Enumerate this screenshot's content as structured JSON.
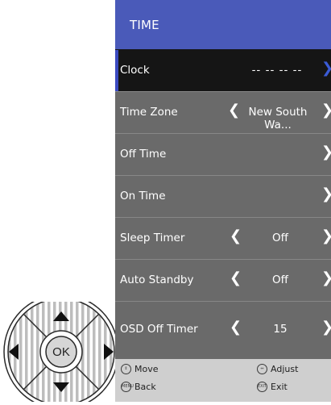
{
  "menu": {
    "title": "TIME",
    "rows": [
      {
        "label": "Clock",
        "value": "-- --   -- --"
      },
      {
        "label": "Time Zone",
        "value": "New South Wa..."
      },
      {
        "label": "Off Time",
        "value": ""
      },
      {
        "label": "On Time",
        "value": ""
      },
      {
        "label": "Sleep Timer",
        "value": "Off"
      },
      {
        "label": "Auto Standby",
        "value": "Off"
      },
      {
        "label": "OSD Off Timer",
        "value": "15"
      }
    ]
  },
  "footer": {
    "move": "Move",
    "adjust": "Adjust",
    "back": "Back",
    "exit": "Exit",
    "menu_key": "MENU",
    "exit_key": "EXIT"
  },
  "remote": {
    "ok_label": "OK"
  },
  "colors": {
    "header": "#4a5ab9",
    "menu_bg": "#6a6a6a",
    "selected_row": "#151515",
    "accent_arrow": "#3b5bd6",
    "footer_bg": "#cfcfcf"
  }
}
